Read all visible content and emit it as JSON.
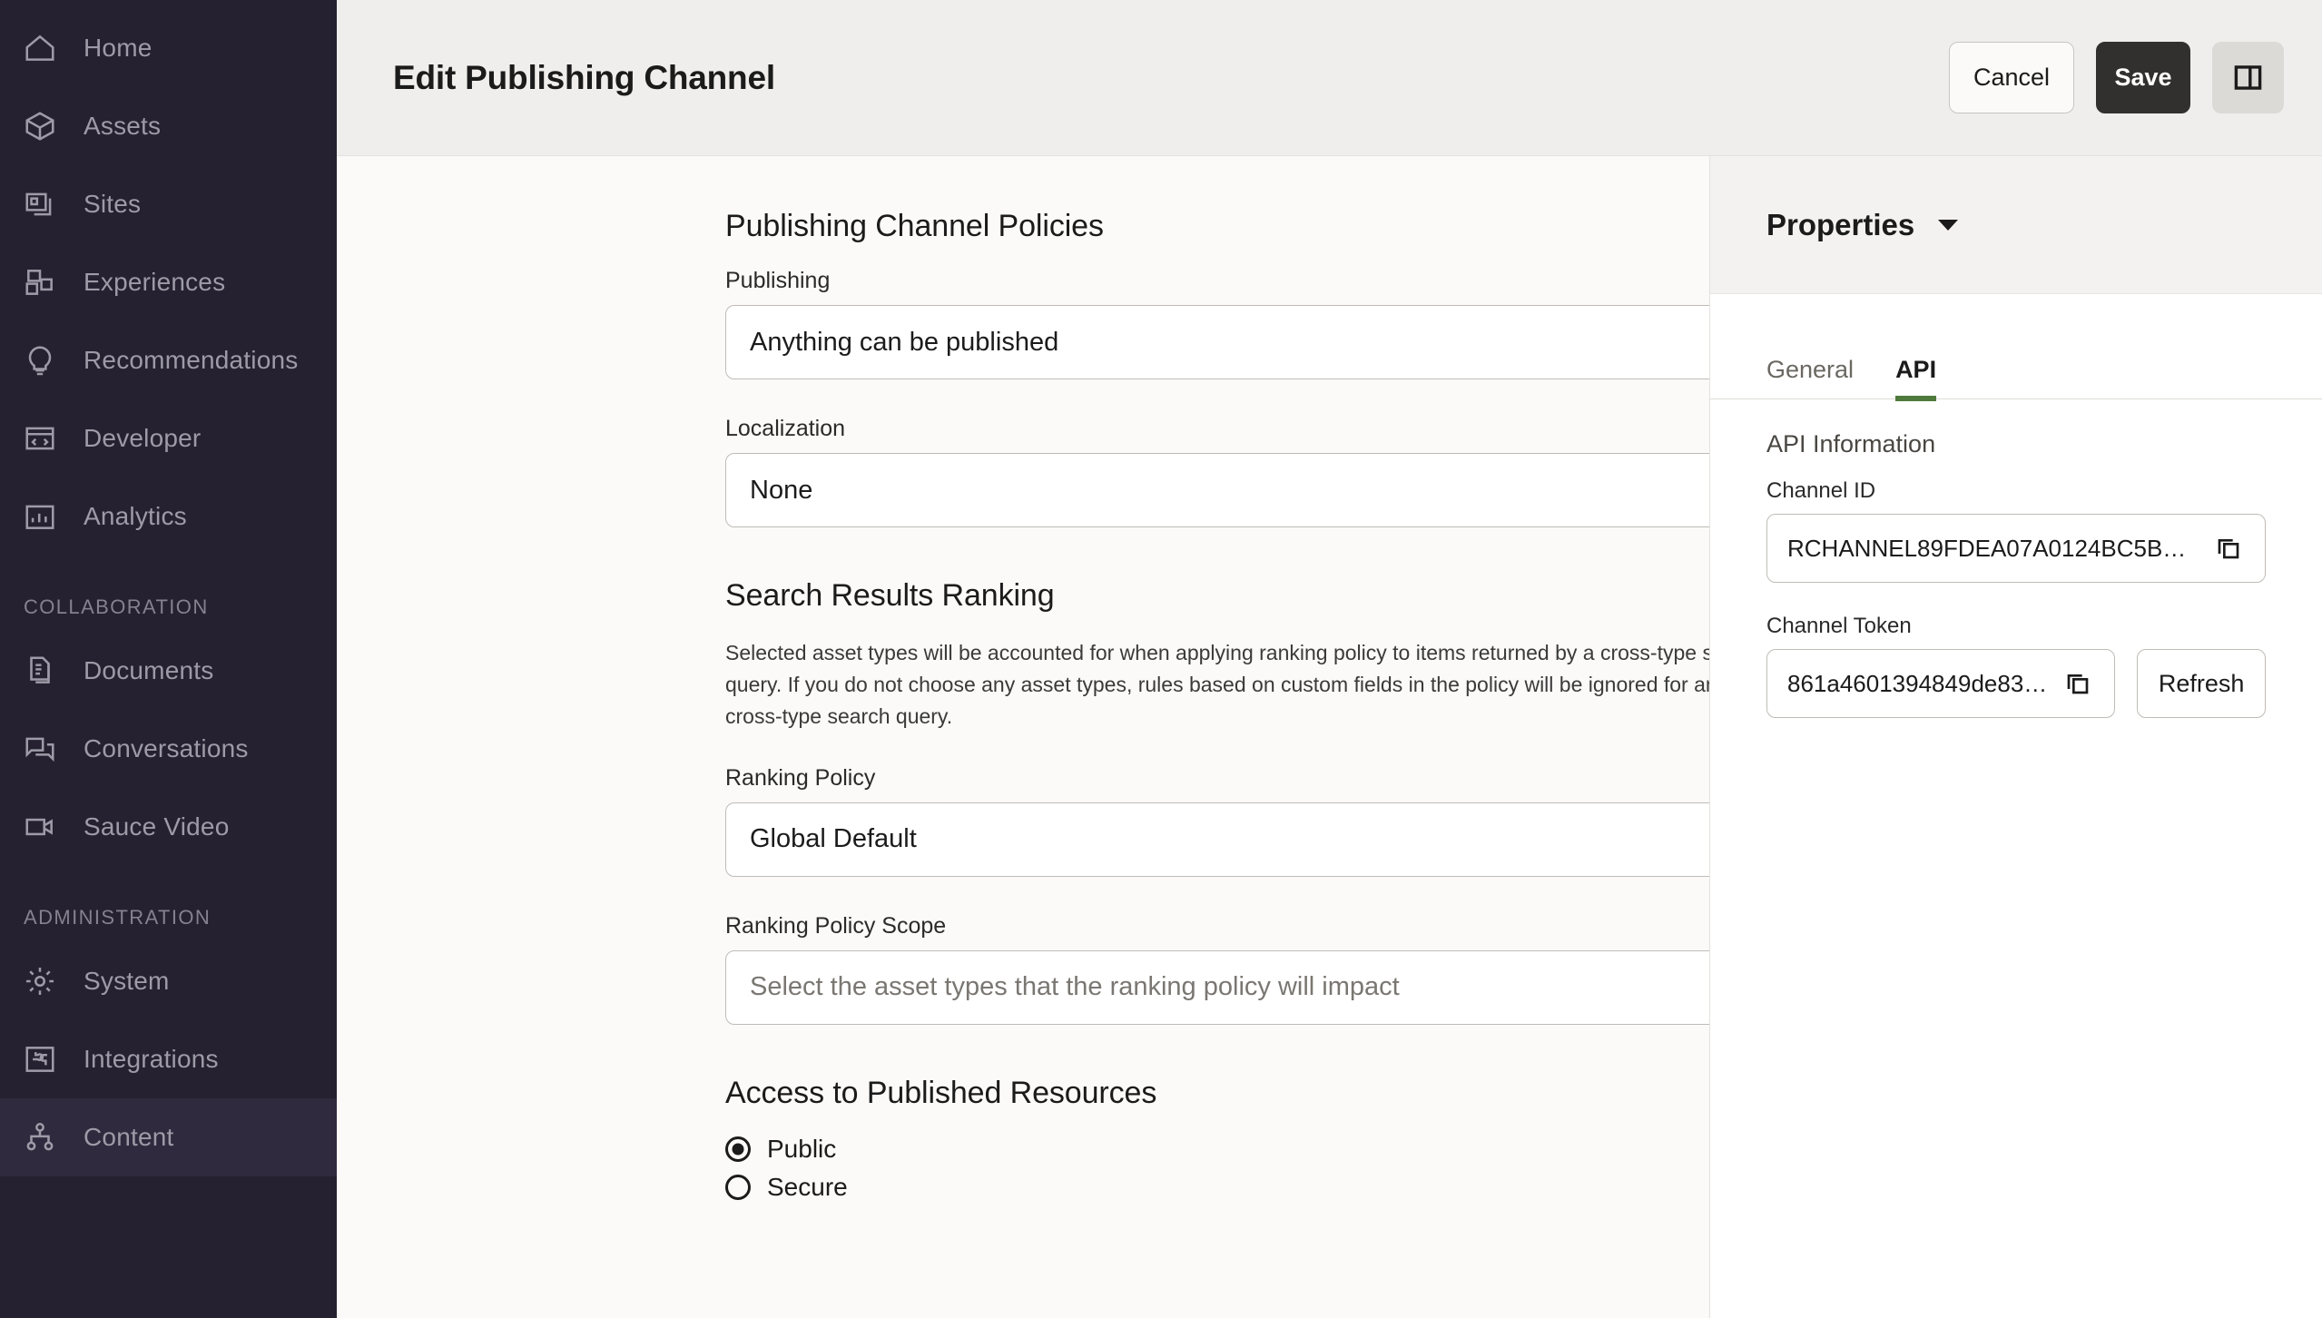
{
  "sidebar": {
    "items": [
      {
        "label": "Home",
        "icon": "home-icon",
        "active": false
      },
      {
        "label": "Assets",
        "icon": "assets-box-icon",
        "active": false
      },
      {
        "label": "Sites",
        "icon": "sites-icon",
        "active": false
      },
      {
        "label": "Experiences",
        "icon": "experiences-icon",
        "active": false
      },
      {
        "label": "Recommendations",
        "icon": "lightbulb-icon",
        "active": false
      },
      {
        "label": "Developer",
        "icon": "code-window-icon",
        "active": false
      },
      {
        "label": "Analytics",
        "icon": "bar-chart-icon",
        "active": false
      }
    ],
    "collaboration_heading": "COLLABORATION",
    "collaboration_items": [
      {
        "label": "Documents",
        "icon": "documents-icon",
        "active": false
      },
      {
        "label": "Conversations",
        "icon": "conversations-icon",
        "active": false
      },
      {
        "label": "Sauce Video",
        "icon": "video-camera-icon",
        "active": false
      }
    ],
    "administration_heading": "ADMINISTRATION",
    "administration_items": [
      {
        "label": "System",
        "icon": "gear-icon",
        "active": false
      },
      {
        "label": "Integrations",
        "icon": "integrations-icon",
        "active": false
      },
      {
        "label": "Content",
        "icon": "content-hierarchy-icon",
        "active": true
      }
    ]
  },
  "header": {
    "title": "Edit Publishing Channel",
    "cancel_label": "Cancel",
    "save_label": "Save",
    "panel_toggle_icon": "split-panel-icon"
  },
  "form": {
    "policies_section_title": "Publishing Channel Policies",
    "publishing_label": "Publishing",
    "publishing_value": "Anything can be published",
    "localization_label": "Localization",
    "localization_value": "None",
    "ranking_section_title": "Search Results Ranking",
    "ranking_help": "Selected asset types will be accounted for when applying ranking policy to items returned by a cross-type search query. If you do not choose any asset types, rules based on custom fields in the policy will be ignored for any cross-type search query.",
    "ranking_policy_label": "Ranking Policy",
    "ranking_policy_value": "Global Default",
    "ranking_scope_label": "Ranking Policy Scope",
    "ranking_scope_placeholder": "Select the asset types that the ranking policy will impact",
    "access_section_title": "Access to Published Resources",
    "access_options": [
      {
        "label": "Public",
        "selected": true
      },
      {
        "label": "Secure",
        "selected": false
      }
    ]
  },
  "properties": {
    "title": "Properties",
    "tabs": [
      {
        "label": "General",
        "active": false
      },
      {
        "label": "API",
        "active": true
      }
    ],
    "api_section_title": "API Information",
    "channel_id_label": "Channel ID",
    "channel_id_value": "RCHANNEL89FDEA07A0124BC5B…",
    "channel_token_label": "Channel Token",
    "channel_token_value": "861a4601394849de83…",
    "refresh_label": "Refresh",
    "copy_icon": "copy-icon"
  },
  "colors": {
    "sidebar_bg": "#252130",
    "sidebar_active_bg": "#2F2A3D",
    "header_bg": "#EFEEEC",
    "content_bg": "#FBFAF8",
    "accent_tab_underline": "#4E7A3C",
    "save_button_bg": "#32302E"
  }
}
